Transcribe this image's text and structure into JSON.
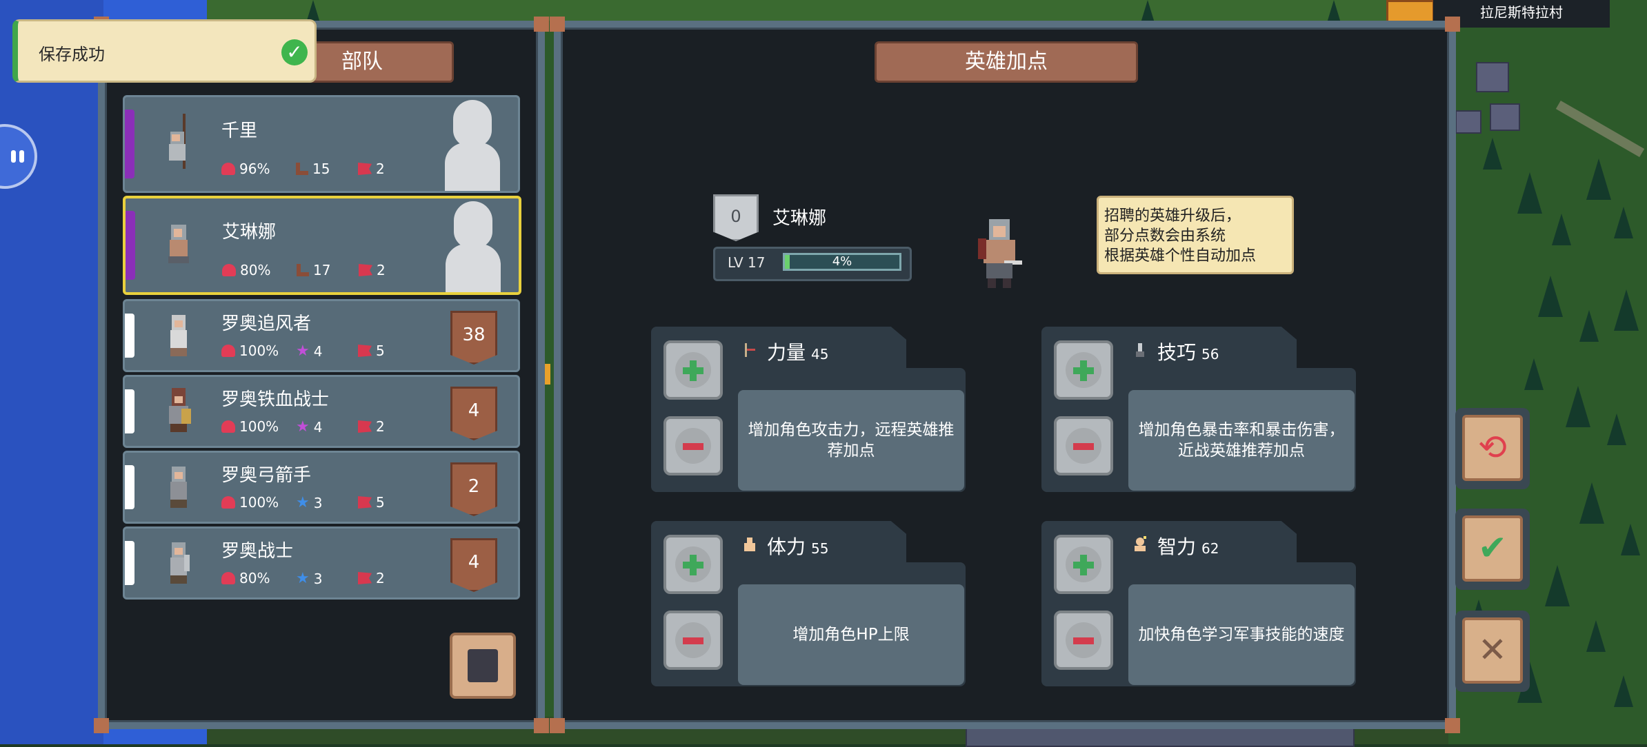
{
  "location": {
    "village_name": "拉尼斯特拉村"
  },
  "toast": {
    "message": "保存成功"
  },
  "left_panel": {
    "title": "部队",
    "units": [
      {
        "name": "千里",
        "hp": "96%",
        "move": "15",
        "flag": "2",
        "rank": "",
        "hero": true,
        "stripe_color": "#8b2fb8"
      },
      {
        "name": "艾琳娜",
        "hp": "80%",
        "move": "17",
        "flag": "2",
        "rank": "",
        "hero": true,
        "stripe_color": "#8b2fb8",
        "selected": true
      },
      {
        "name": "罗奥追风者",
        "hp": "100%",
        "star": "4",
        "star_color": "purple",
        "flag": "5",
        "rank": "38"
      },
      {
        "name": "罗奥铁血战士",
        "hp": "100%",
        "star": "4",
        "star_color": "purple",
        "flag": "2",
        "rank": "4"
      },
      {
        "name": "罗奥弓箭手",
        "hp": "100%",
        "star": "3",
        "star_color": "blue",
        "flag": "5",
        "rank": "2"
      },
      {
        "name": "罗奥战士",
        "hp": "80%",
        "star": "3",
        "star_color": "blue",
        "flag": "2",
        "rank": "4"
      }
    ]
  },
  "right_panel": {
    "title": "英雄加点",
    "hero": {
      "name": "艾琳娜",
      "points": "0",
      "level": "LV 17",
      "xp_text": "4%",
      "xp_fraction": 0.04
    },
    "tip": [
      "招聘的英雄升级后，",
      "部分点数会由系统",
      "根据英雄个性自动加点"
    ],
    "attributes": [
      {
        "label": "力量",
        "value": "45",
        "description": "增加角色攻击力，远程英雄推荐加点"
      },
      {
        "label": "技巧",
        "value": "56",
        "description": "增加角色暴击率和暴击伤害，近战英雄推荐加点"
      },
      {
        "label": "体力",
        "value": "55",
        "description": "增加角色HP上限"
      },
      {
        "label": "智力",
        "value": "62",
        "description": "加快角色学习军事技能的速度"
      }
    ]
  },
  "colors": {
    "plus": "#3fa85a",
    "minus": "#d43c4d",
    "selected_border": "#e9d13d"
  },
  "icons": {
    "reset": "reset-icon",
    "confirm": "check-icon",
    "close": "close-icon",
    "book": "book-icon"
  }
}
